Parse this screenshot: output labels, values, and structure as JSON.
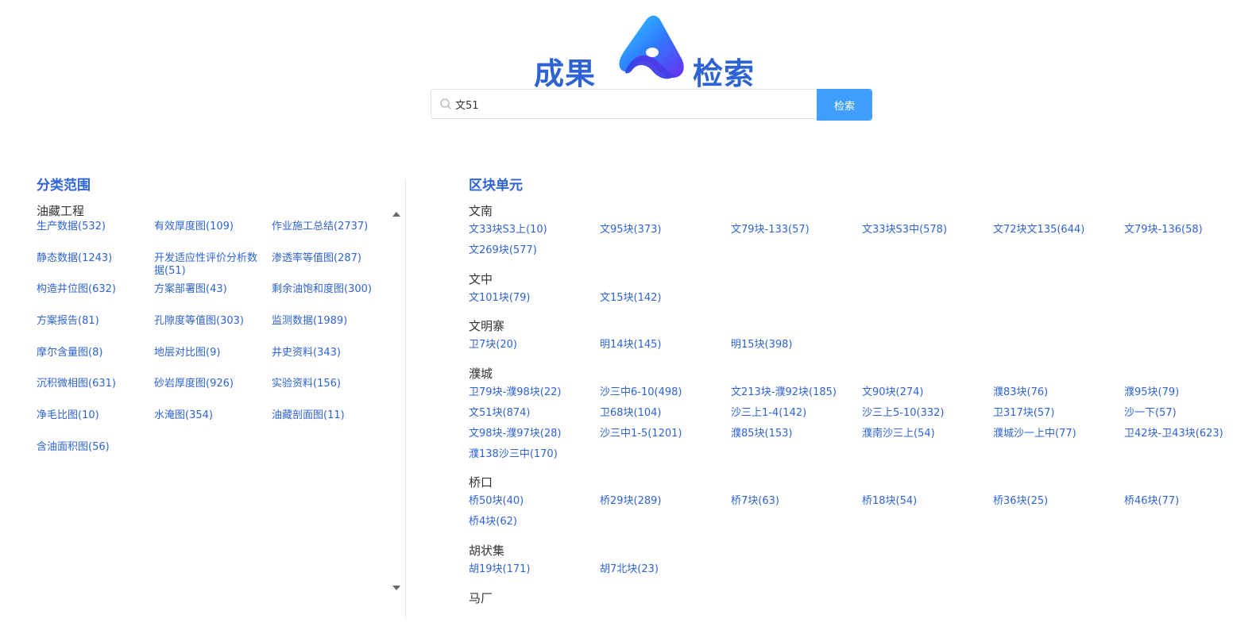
{
  "logo": {
    "left_text": "成果",
    "right_text": "检索"
  },
  "search": {
    "value": "文51",
    "placeholder": "",
    "button_label": "检索"
  },
  "left": {
    "title": "分类范围",
    "group": "油藏工程",
    "items": [
      "生产数据(532)",
      "有效厚度图(109)",
      "作业施工总结(2737)",
      "静态数据(1243)",
      "开发适应性评价分析数据(51)",
      "渗透率等值图(287)",
      "构造井位图(632)",
      "方案部署图(43)",
      "剩余油饱和度图(300)",
      "方案报告(81)",
      "孔隙度等值图(303)",
      "监测数据(1989)",
      "摩尔含量图(8)",
      "地层对比图(9)",
      "井史资料(343)",
      "沉积微相图(631)",
      "砂岩厚度图(926)",
      "实验资料(156)",
      "净毛比图(10)",
      "水淹图(354)",
      "油藏剖面图(11)",
      "含油面积图(56)"
    ]
  },
  "right": {
    "title": "区块单元",
    "regions": [
      {
        "name": "文南",
        "units": [
          "文33块S3上(10)",
          "文95块(373)",
          "文79块-133(57)",
          "文33块S3中(578)",
          "文72块文135(644)",
          "文79块-136(58)",
          "文269块(577)"
        ]
      },
      {
        "name": "文中",
        "units": [
          "文101块(79)",
          "文15块(142)"
        ]
      },
      {
        "name": "文明寨",
        "units": [
          "卫7块(20)",
          "明14块(145)",
          "明15块(398)"
        ]
      },
      {
        "name": "濮城",
        "units": [
          "卫79块-濮98块(22)",
          "沙三中6-10(498)",
          "文213块-濮92块(185)",
          "文90块(274)",
          "濮83块(76)",
          "濮95块(79)",
          "文51块(874)",
          "卫68块(104)",
          "沙三上1-4(142)",
          "沙三上5-10(332)",
          "卫317块(57)",
          "沙一下(57)",
          "文98块-濮97块(28)",
          "沙三中1-5(1201)",
          "濮85块(153)",
          "濮南沙三上(54)",
          "濮城沙一上中(77)",
          "卫42块-卫43块(623)",
          "濮138沙三中(170)"
        ]
      },
      {
        "name": "桥口",
        "units": [
          "桥50块(40)",
          "桥29块(289)",
          "桥7块(63)",
          "桥18块(54)",
          "桥36块(25)",
          "桥46块(77)",
          "桥4块(62)"
        ]
      },
      {
        "name": "胡状集",
        "units": [
          "胡19块(171)",
          "胡7北块(23)"
        ]
      },
      {
        "name": "马厂",
        "units": []
      }
    ]
  },
  "colors": {
    "accent": "#2e63d4",
    "button": "#409eff"
  }
}
